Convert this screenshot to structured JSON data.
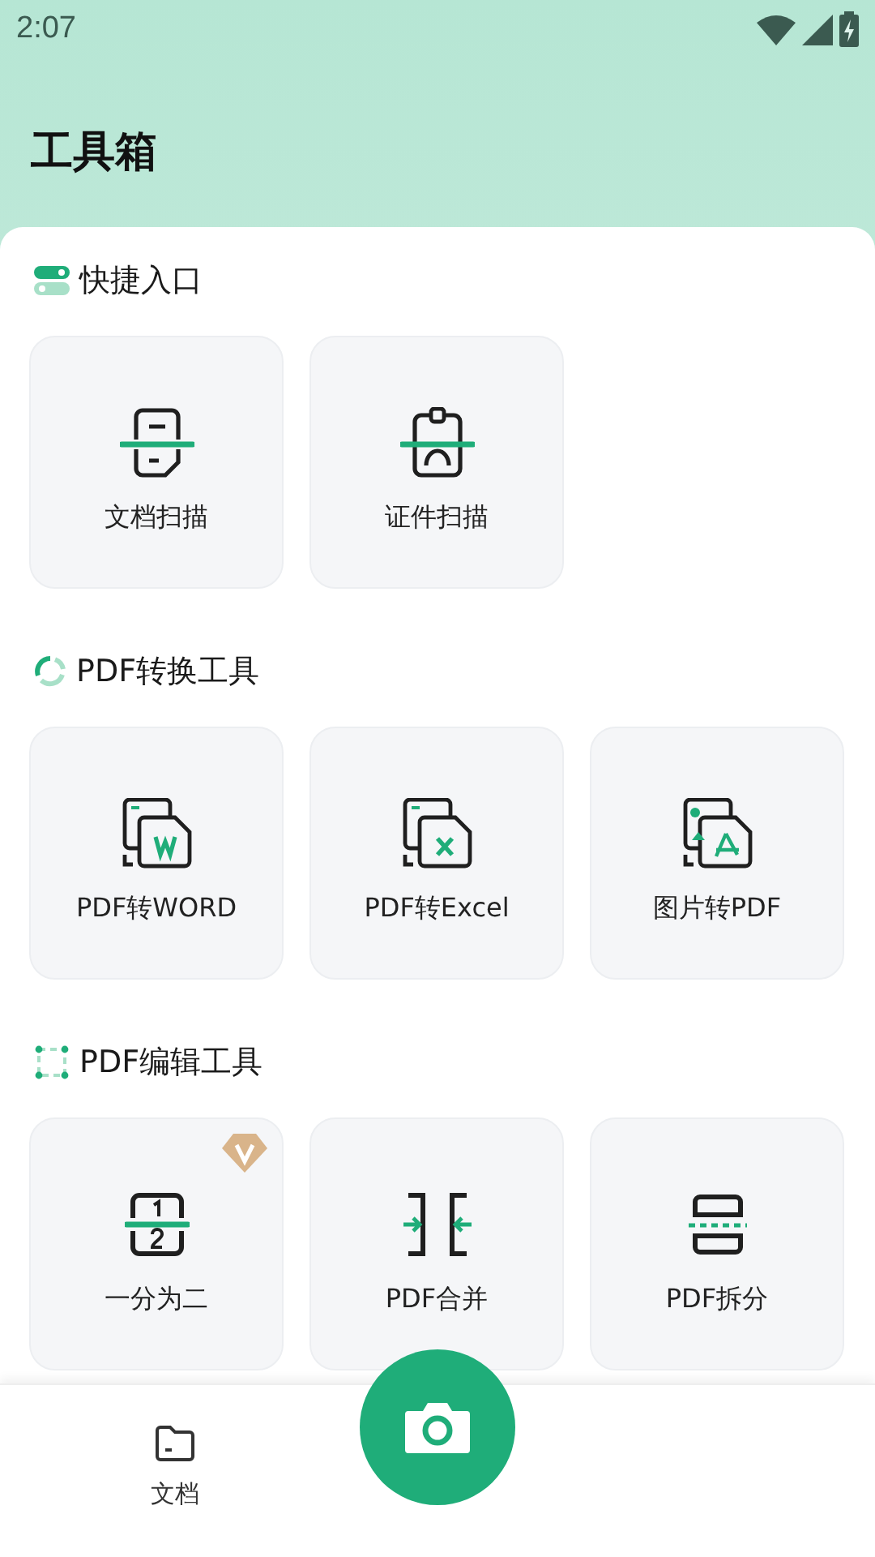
{
  "status_bar": {
    "time": "2:07"
  },
  "header": {
    "title": "工具箱"
  },
  "sections": [
    {
      "title": "快捷入口",
      "tiles": [
        {
          "label": "文档扫描",
          "vip": false
        },
        {
          "label": "证件扫描",
          "vip": false
        }
      ]
    },
    {
      "title": "PDF转换工具",
      "tiles": [
        {
          "label": "PDF转WORD",
          "vip": false
        },
        {
          "label": "PDF转Excel",
          "vip": false
        },
        {
          "label": "图片转PDF",
          "vip": false
        }
      ]
    },
    {
      "title": "PDF编辑工具",
      "tiles": [
        {
          "label": "一分为二",
          "vip": true
        },
        {
          "label": "PDF合并",
          "vip": false
        },
        {
          "label": "PDF拆分",
          "vip": false
        }
      ]
    }
  ],
  "bottom_nav": {
    "items": [
      {
        "label": "文档"
      }
    ]
  }
}
